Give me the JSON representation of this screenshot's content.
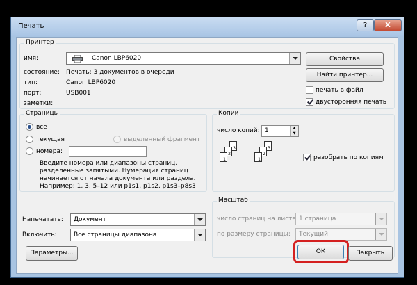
{
  "window": {
    "title": "Печать",
    "help": "?",
    "close": "X"
  },
  "printer": {
    "group_title": "Принтер",
    "name_label": "имя:",
    "name_value": "Canon LBP6020",
    "status_label": "состояние:",
    "status_value": "Печать: 3 документов в очереди",
    "type_label": "тип:",
    "type_value": "Canon LBP6020",
    "port_label": "порт:",
    "port_value": "USB001",
    "notes_label": "заметки:",
    "properties_button": "Свойства",
    "find_printer_button": "Найти принтер...",
    "print_to_file_label": "печать в файл",
    "print_to_file_checked": false,
    "duplex_label": "двусторонняя печать",
    "duplex_checked": true
  },
  "pages": {
    "group_title": "Страницы",
    "all_label": "все",
    "current_label": "текущая",
    "selection_label": "выделенный фрагмент",
    "numbers_label": "номера:",
    "numbers_value": "",
    "selected_option": "все",
    "hint": [
      "Введите номера или диапазоны страниц,",
      "разделенные запятыми. Нумерация страниц",
      "начинается от начала документа или раздела.",
      "Например: 1, 3, 5–12 или p1s1, p1s2, p1s3–p8s3"
    ]
  },
  "copies": {
    "group_title": "Копии",
    "count_label": "число копий:",
    "count_value": "1",
    "collate_label": "разобрать по копиям",
    "collate_checked": true
  },
  "print_what": {
    "label": "Напечатать:",
    "value": "Документ"
  },
  "include": {
    "label": "Включить:",
    "value": "Все страницы диапазона"
  },
  "zoom": {
    "group_title": "Масштаб",
    "pages_per_sheet_label": "число страниц на листе:",
    "pages_per_sheet_value": "1 страница",
    "scale_label": "по размеру страницы:",
    "scale_value": "Текущий"
  },
  "buttons": {
    "options": "Параметры...",
    "ok": "ОК",
    "close": "Закрыть"
  },
  "colors": {
    "highlight": "#d42020",
    "titlebar": "#a9c5e5",
    "dialog_bg": "#f0f0f0"
  }
}
